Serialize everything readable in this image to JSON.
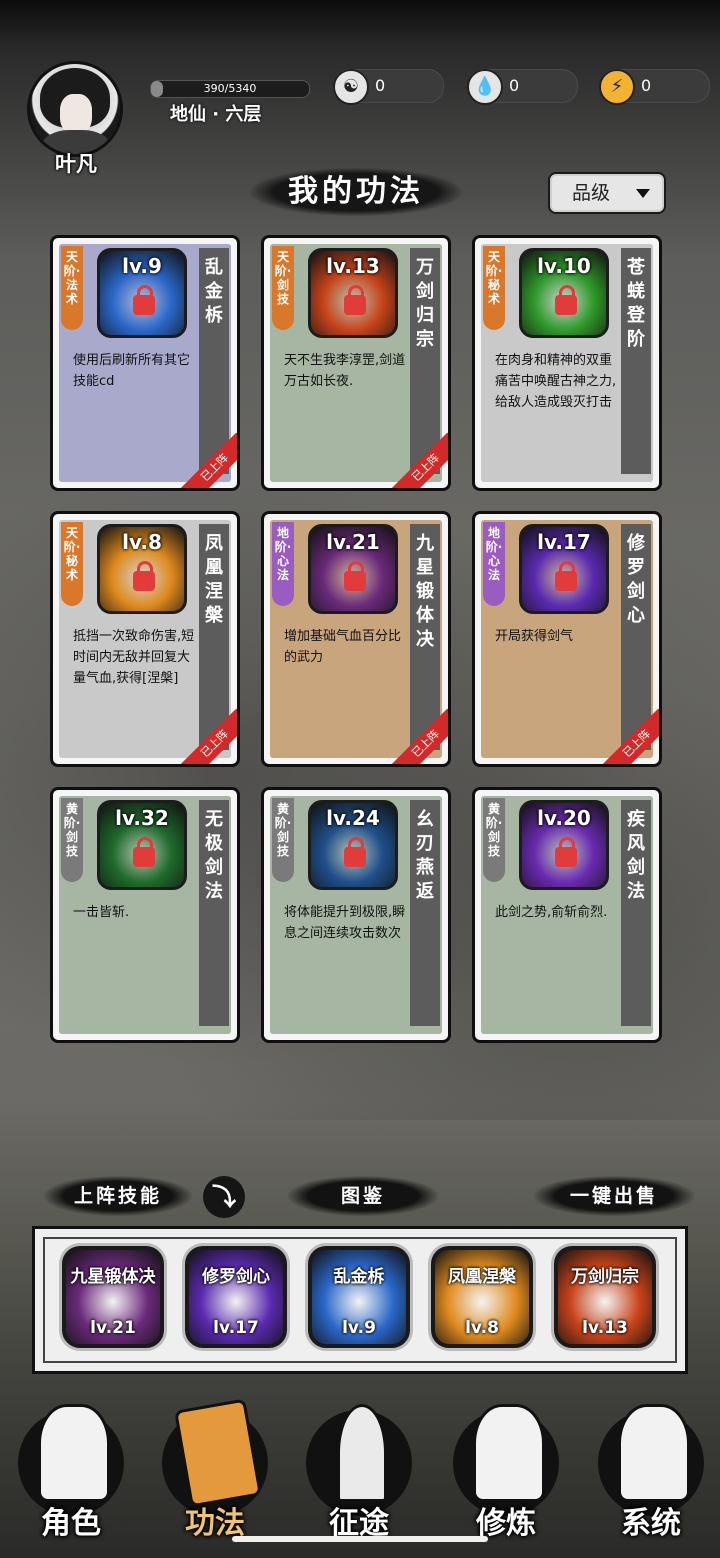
{
  "player": {
    "name": "叶凡",
    "exp": {
      "text": "390/5340",
      "progress": 0.073
    },
    "realm": "地仙 · 六层"
  },
  "resources": [
    {
      "icon": "yin-yang-icon",
      "value": "0"
    },
    {
      "icon": "water-drop-icon",
      "value": "0"
    },
    {
      "icon": "lightning-icon",
      "value": "0"
    }
  ],
  "header": {
    "title": "我的功法",
    "filter_label": "品级"
  },
  "cards": [
    {
      "grade": "天阶·法术",
      "grade_color": "#d9772b",
      "level": "lv.9",
      "name": "乱金柝",
      "desc": "使用后刷新所有其它技能cd",
      "bg": "#a9aacb",
      "icon_bg": "#2a67c9",
      "equipped": "已上阵"
    },
    {
      "grade": "天阶·剑技",
      "grade_color": "#d9772b",
      "level": "lv.13",
      "name": "万剑归宗",
      "desc": "天不生我李淳罡,剑道万古如长夜.",
      "bg": "#a7b6a2",
      "icon_bg": "#c8431a",
      "equipped": "已上阵"
    },
    {
      "grade": "天阶·秘术",
      "grade_color": "#d9772b",
      "level": "lv.10",
      "name": "苍蜣登阶",
      "desc": "在肉身和精神的双重痛苦中唤醒古神之力,给敌人造成毁灭打击",
      "bg": "#c9c9c9",
      "icon_bg": "#2f9a2a",
      "equipped": ""
    },
    {
      "grade": "天阶·秘术",
      "grade_color": "#d9772b",
      "level": "lv.8",
      "name": "凤凰涅槃",
      "desc": "抵挡一次致命伤害,短时间内无敌并回复大量气血,获得[涅槃]",
      "bg": "#c9c9c9",
      "icon_bg": "#e08a1e",
      "equipped": "已上阵"
    },
    {
      "grade": "地阶·心法",
      "grade_color": "#9a5cc0",
      "level": "lv.21",
      "name": "九星锻体决",
      "desc": "增加基础气血百分比的武力",
      "bg": "#c9a57e",
      "icon_bg": "#6a2a7a",
      "equipped": "已上阵"
    },
    {
      "grade": "地阶·心法",
      "grade_color": "#9a5cc0",
      "level": "lv.17",
      "name": "修罗剑心",
      "desc": "开局获得剑气",
      "bg": "#c9a57e",
      "icon_bg": "#5a2ab0",
      "equipped": "已上阵"
    },
    {
      "grade": "黄阶·剑技",
      "grade_color": "#7a7a7a",
      "level": "lv.32",
      "name": "无极剑法",
      "desc": "一击皆斩.",
      "bg": "#a7b6a2",
      "icon_bg": "#1f6b2c",
      "equipped": ""
    },
    {
      "grade": "黄阶·剑技",
      "grade_color": "#7a7a7a",
      "level": "lv.24",
      "name": "幺刃燕返",
      "desc": "将体能提升到极限,瞬息之间连续攻击数次",
      "bg": "#a7b6a2",
      "icon_bg": "#1f4f8a",
      "equipped": ""
    },
    {
      "grade": "黄阶·剑技",
      "grade_color": "#7a7a7a",
      "level": "lv.20",
      "name": "疾风剑法",
      "desc": "此剑之势,俞斩俞烈.",
      "bg": "#a7b6a2",
      "icon_bg": "#6a2ab0",
      "equipped": ""
    }
  ],
  "deck": {
    "label": "上阵技能",
    "gallery_label": "图鉴",
    "sell_label": "一键出售",
    "slots": [
      {
        "name": "九星锻体决",
        "level": "lv.21",
        "bg": "#6a2a7a"
      },
      {
        "name": "修罗剑心",
        "level": "lv.17",
        "bg": "#5a2ab0"
      },
      {
        "name": "乱金柝",
        "level": "lv.9",
        "bg": "#2a67c9"
      },
      {
        "name": "凤凰涅槃",
        "level": "lv.8",
        "bg": "#e08a1e"
      },
      {
        "name": "万剑归宗",
        "level": "lv.13",
        "bg": "#c8431a"
      }
    ]
  },
  "nav": [
    {
      "label": "角色",
      "icon": "hooded-figure-icon"
    },
    {
      "label": "功法",
      "icon": "scroll-book-icon"
    },
    {
      "label": "征途",
      "icon": "sword-emblem-icon"
    },
    {
      "label": "修炼",
      "icon": "meditating-figure-icon"
    },
    {
      "label": "系统",
      "icon": "mascot-face-icon"
    }
  ]
}
